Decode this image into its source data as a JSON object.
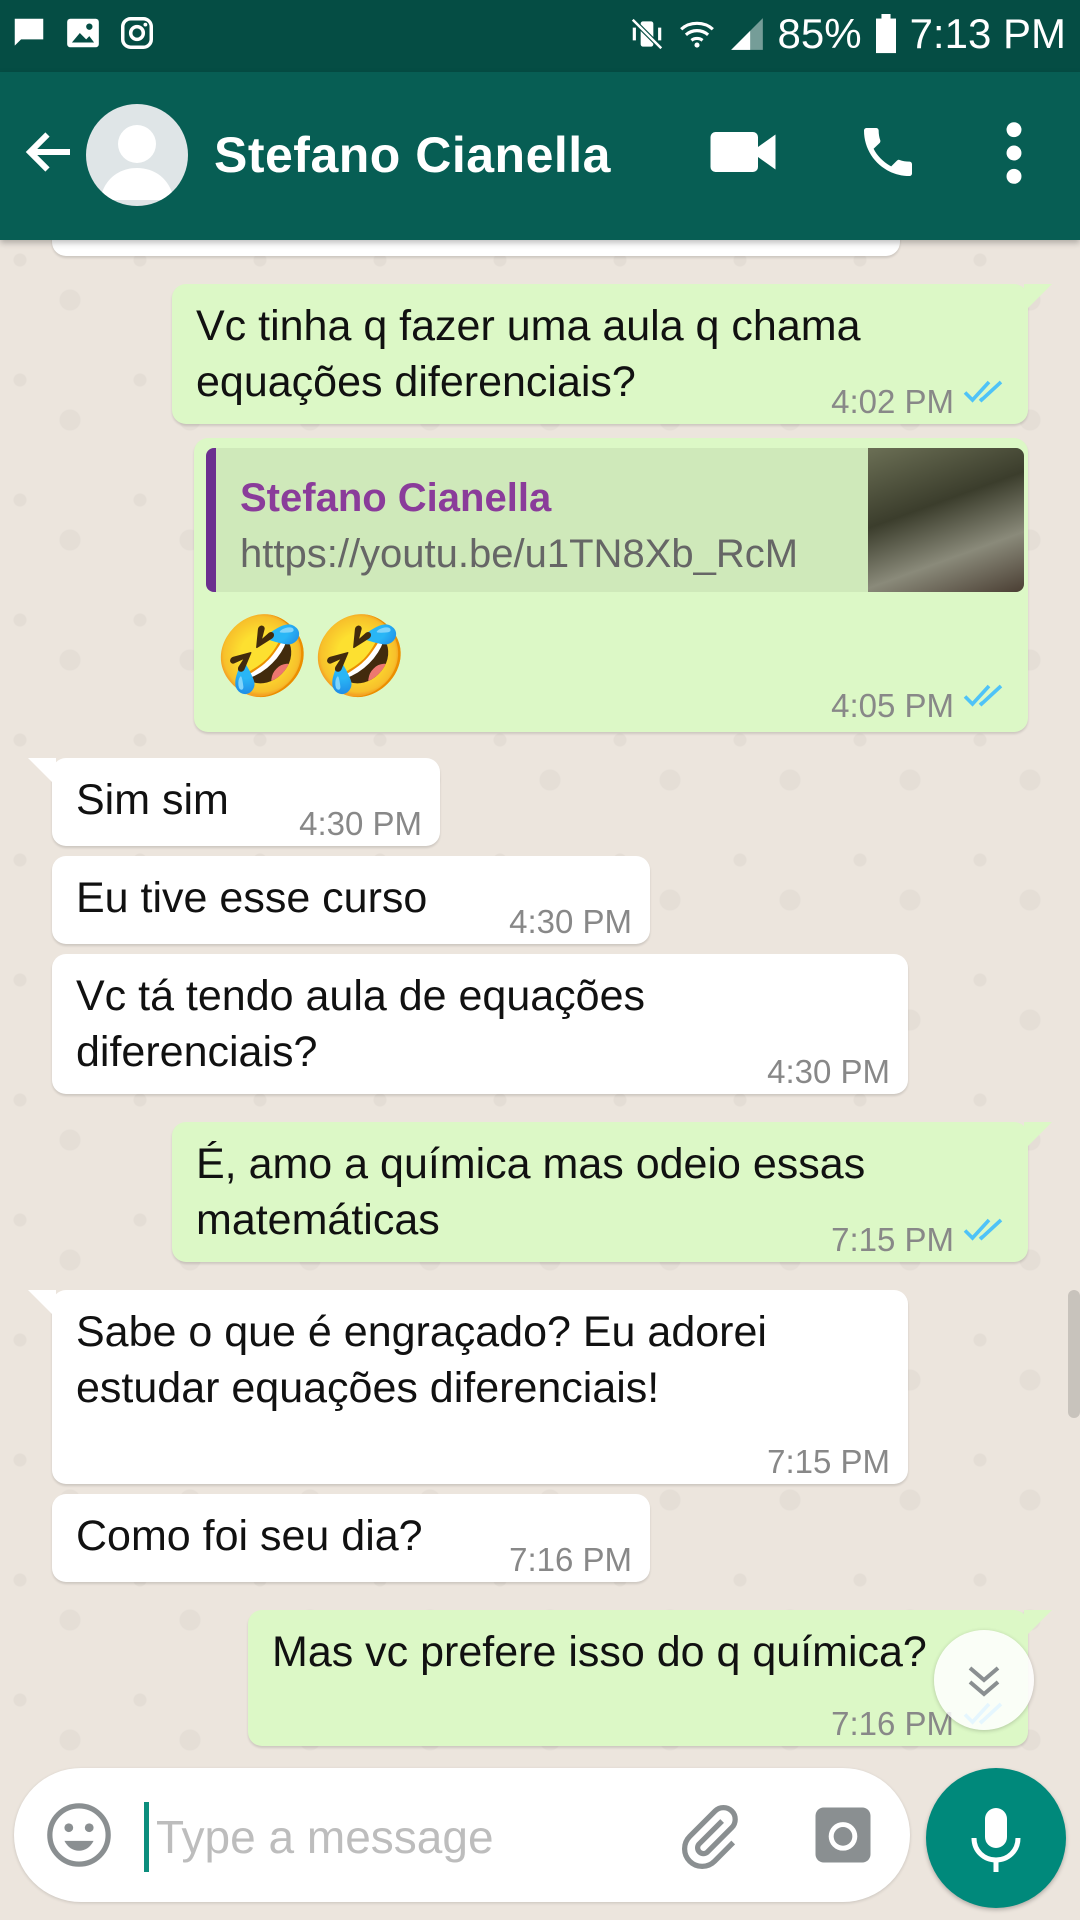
{
  "status_bar": {
    "battery": "85%",
    "time": "7:13 PM"
  },
  "header": {
    "contact_name": "Stefano Cianella"
  },
  "messages": [
    {
      "text_line1": "Vc tinha q fazer uma aula q chama",
      "text_line2": "equações diferenciais?",
      "time": "4:02 PM",
      "direction": "out"
    },
    {
      "quote_name": "Stefano Cianella",
      "quote_link": "https://youtu.be/u1TN8Xb_RcM",
      "text": "🤣🤣",
      "time": "4:05 PM",
      "direction": "out"
    },
    {
      "text": "Sim sim",
      "time": "4:30 PM",
      "direction": "in"
    },
    {
      "text": "Eu tive esse curso",
      "time": "4:30 PM",
      "direction": "in"
    },
    {
      "text_line1": "Vc tá tendo aula de equações",
      "text_line2": "diferenciais?",
      "time": "4:30 PM",
      "direction": "in"
    },
    {
      "text_line1": "É, amo a química mas odeio essas",
      "text_line2": "matemáticas",
      "time": "7:15 PM",
      "direction": "out"
    },
    {
      "text_line1": "Sabe o que é engraçado? Eu adorei",
      "text_line2": "estudar equações diferenciais!",
      "time": "7:15 PM",
      "direction": "in"
    },
    {
      "text": "Como foi seu dia?",
      "time": "7:16 PM",
      "direction": "in"
    },
    {
      "text": "Mas vc prefere isso do q química?",
      "time": "7:16 PM",
      "direction": "out"
    }
  ],
  "composer": {
    "placeholder": "Type a message"
  },
  "icons": {
    "back": "arrow-left-icon",
    "video": "video-camera-icon",
    "call": "phone-icon",
    "menu": "more-vert-icon",
    "emoji": "emoji-icon",
    "attach": "paperclip-icon",
    "camera": "camera-icon",
    "mic": "microphone-icon",
    "scroll": "chevron-double-down-icon"
  },
  "colors": {
    "header": "#075e54",
    "status_bar": "#054d44",
    "outgoing_bubble": "#dcf8c6",
    "incoming_bubble": "#ffffff",
    "read_ticks": "#4fc3f7",
    "fab": "#00897b"
  }
}
